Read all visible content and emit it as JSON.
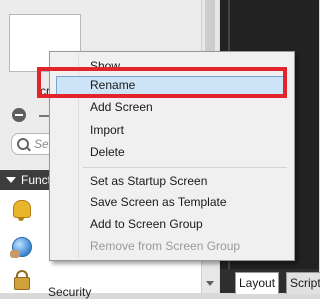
{
  "left_panel": {
    "screen_name_fragment": "cr",
    "search_placeholder": "Se",
    "functions_title": "Funct",
    "function_items": [
      {
        "icon": "bell-icon",
        "label": ""
      },
      {
        "icon": "globe-icon",
        "label": ""
      },
      {
        "icon": "lock-icon",
        "label": "Security"
      }
    ]
  },
  "context_menu": {
    "items_group1": [
      "Show",
      "Rename",
      "Add Screen",
      "Import",
      "Delete"
    ],
    "items_group2": [
      "Set as Startup Screen",
      "Save Screen as Template",
      "Add to Screen Group",
      "Remove from Screen Group"
    ],
    "highlighted": "Rename",
    "disabled": [
      "Remove from Screen Group"
    ]
  },
  "bottom_tabs": {
    "layout": "Layout",
    "script": "Script"
  },
  "colors": {
    "highlight_box": "#e3242b",
    "menu_hover": "#cde4f7"
  }
}
